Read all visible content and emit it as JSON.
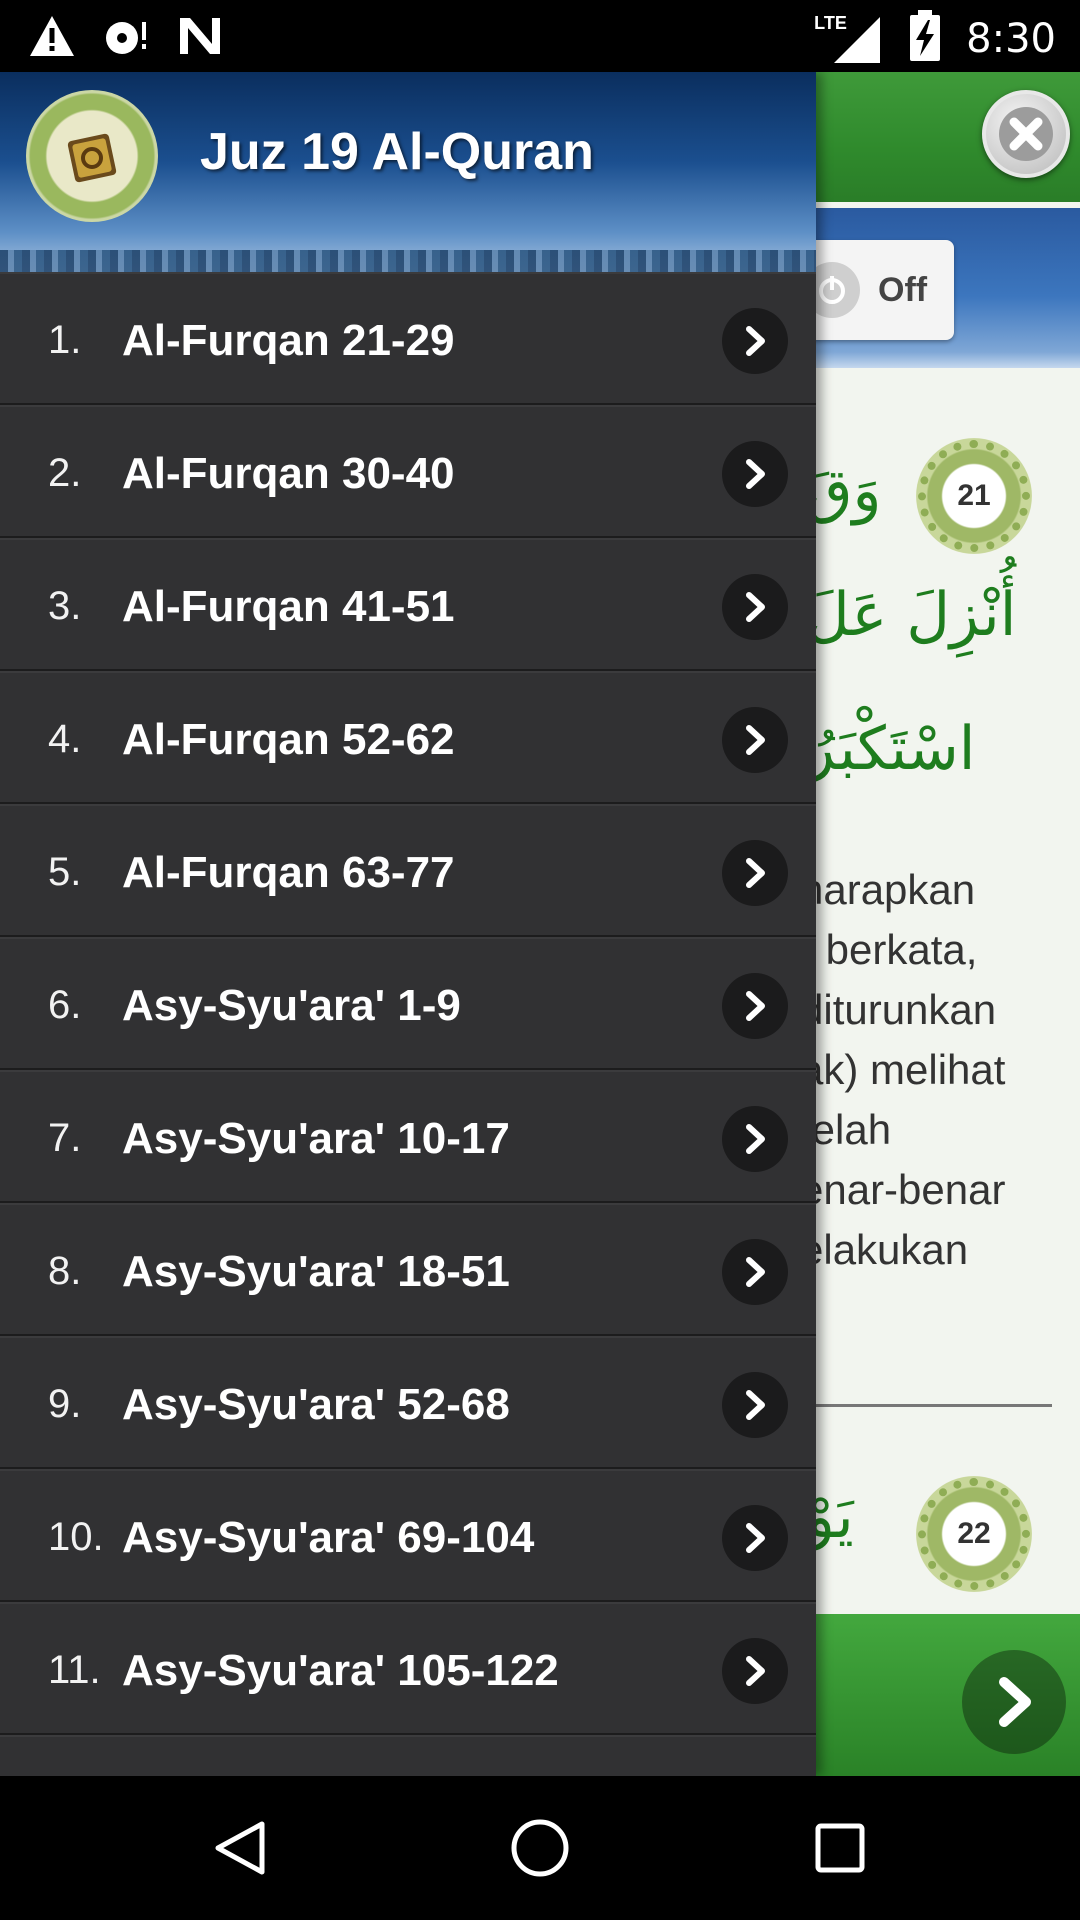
{
  "status_bar": {
    "time": "8:30",
    "network_label": "LTE",
    "icons": [
      "warning-icon",
      "sync-disc-icon",
      "n-icon",
      "lte-signal-icon",
      "battery-charging-icon"
    ]
  },
  "drawer": {
    "title": "Juz 19 Al-Quran",
    "logo": "quran-logo-icon",
    "items": [
      {
        "num": "1.",
        "label": "Al-Furqan 21-29"
      },
      {
        "num": "2.",
        "label": "Al-Furqan 30-40"
      },
      {
        "num": "3.",
        "label": "Al-Furqan 41-51"
      },
      {
        "num": "4.",
        "label": "Al-Furqan 52-62"
      },
      {
        "num": "5.",
        "label": "Al-Furqan 63-77"
      },
      {
        "num": "6.",
        "label": "Asy-Syu'ara' 1-9"
      },
      {
        "num": "7.",
        "label": "Asy-Syu'ara' 10-17"
      },
      {
        "num": "8.",
        "label": "Asy-Syu'ara' 18-51"
      },
      {
        "num": "9.",
        "label": "Asy-Syu'ara' 52-68"
      },
      {
        "num": "10.",
        "label": "Asy-Syu'ara' 69-104"
      },
      {
        "num": "11.",
        "label": "Asy-Syu'ara' 105-122"
      }
    ]
  },
  "main": {
    "toggle_label": "Off",
    "verse_1": {
      "number": "21",
      "arabic_lines": [
        "وَقَ",
        "أُنْزِلَ عَلَ",
        "اسْتَكْبَرُ"
      ]
    },
    "translation_lines": [
      "harapkan",
      ") berkata,",
      " diturunkan",
      "ak) melihat",
      "telah",
      "enar-benar",
      "elakukan"
    ],
    "verse_2": {
      "number": "22",
      "arabic_line": "يَوْ"
    }
  },
  "colors": {
    "green_header": "#2f8a2c",
    "drawer_bg": "#303032",
    "arabic_text": "#1e7d1e"
  }
}
